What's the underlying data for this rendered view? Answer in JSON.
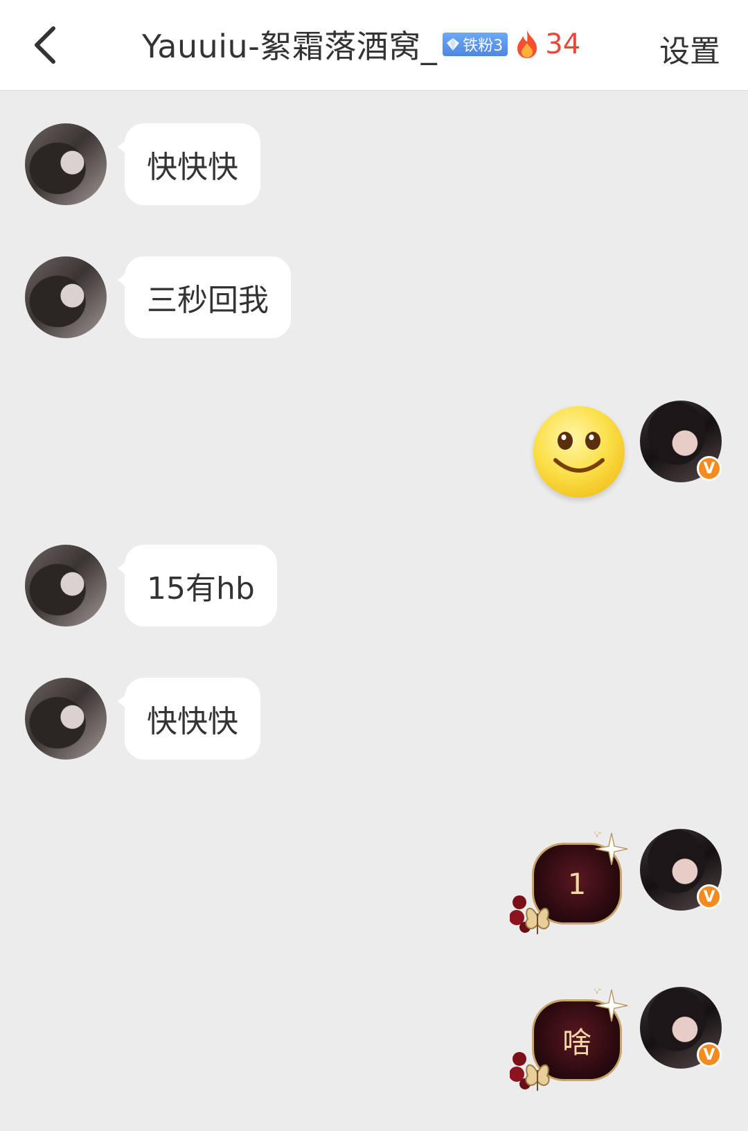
{
  "header": {
    "title": "Yauuiu-絮霜落酒窝_",
    "fan_badge": "铁粉3",
    "fire_count": "34",
    "settings_label": "设置"
  },
  "messages": [
    {
      "side": "left",
      "text": "快快快"
    },
    {
      "side": "left",
      "text": "三秒回我"
    },
    {
      "side": "right",
      "type": "emoji",
      "emoji": "smile-emoji"
    },
    {
      "side": "left",
      "text": "15有hb"
    },
    {
      "side": "left",
      "text": "快快快"
    },
    {
      "side": "right",
      "type": "decorated",
      "text": "1"
    },
    {
      "side": "right",
      "type": "decorated",
      "text": "啥"
    }
  ],
  "colors": {
    "background": "#ececec",
    "header_bg": "#ffffff",
    "fire": "#e8473a",
    "badge_blue": "#4d87e2",
    "verified_orange": "#f58b1f",
    "dark_bubble": "#2a0a0f",
    "dark_bubble_text": "#f2d9a6"
  },
  "icons": [
    "back-chevron-icon",
    "diamond-icon",
    "fire-icon",
    "verified-v-icon",
    "sparkle-icon",
    "butterfly-rose-icon"
  ]
}
